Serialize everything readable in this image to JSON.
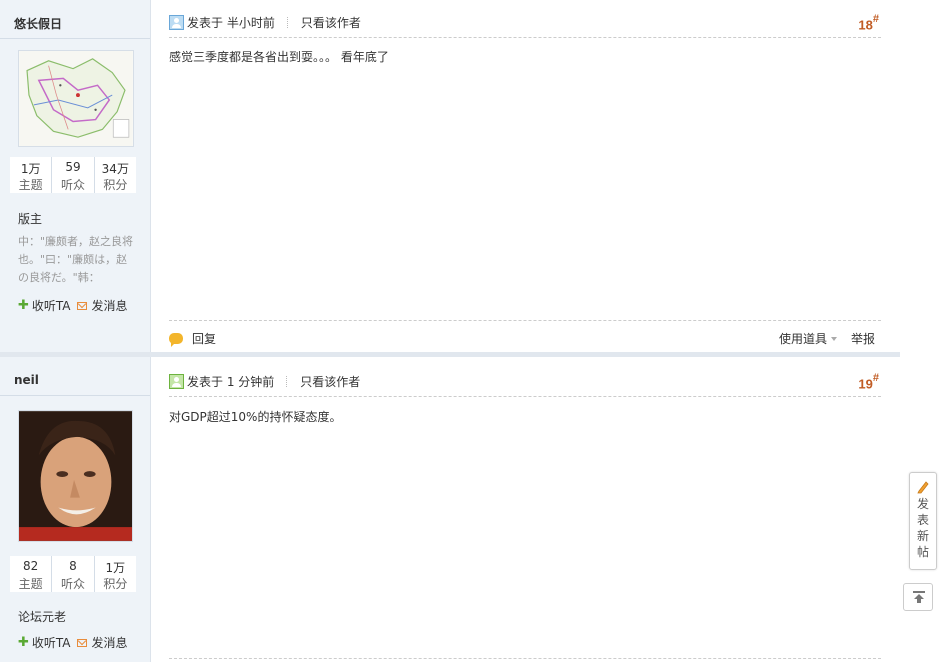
{
  "posts": [
    {
      "username": "悠长假日",
      "stats": [
        {
          "value": "1万",
          "label": "主题"
        },
        {
          "value": "59",
          "label": "听众"
        },
        {
          "value": "34万",
          "label": "积分"
        }
      ],
      "title": "版主",
      "signature": "中：\"廉颇者，赵之良将也。\"曰：\"廉颇は，赵の良将だ。\"韩：",
      "follow_label": "收听TA",
      "message_label": "发消息",
      "post_time": "发表于 半小时前",
      "only_author": "只看该作者",
      "floor": "18",
      "floor_mark": "#",
      "body": "感觉三季度都是各省出到耍。。。  看年底了",
      "reply_label": "回复",
      "tools_label": "使用道具",
      "report_label": "举报"
    },
    {
      "username": "neil",
      "stats": [
        {
          "value": "82",
          "label": "主题"
        },
        {
          "value": "8",
          "label": "听众"
        },
        {
          "value": "1万",
          "label": "积分"
        }
      ],
      "title": "论坛元老",
      "follow_label": "收听TA",
      "message_label": "发消息",
      "post_time": "发表于 1 分钟前",
      "only_author": "只看该作者",
      "floor": "19",
      "floor_mark": "#",
      "body": "对GDP超过10%的持怀疑态度。"
    }
  ],
  "float": {
    "new_post_label": "发表新帖"
  },
  "colors": {
    "sidebar_bg": "#eef3f8",
    "floor_number": "#c15c24",
    "follow_green": "#5aa934"
  }
}
